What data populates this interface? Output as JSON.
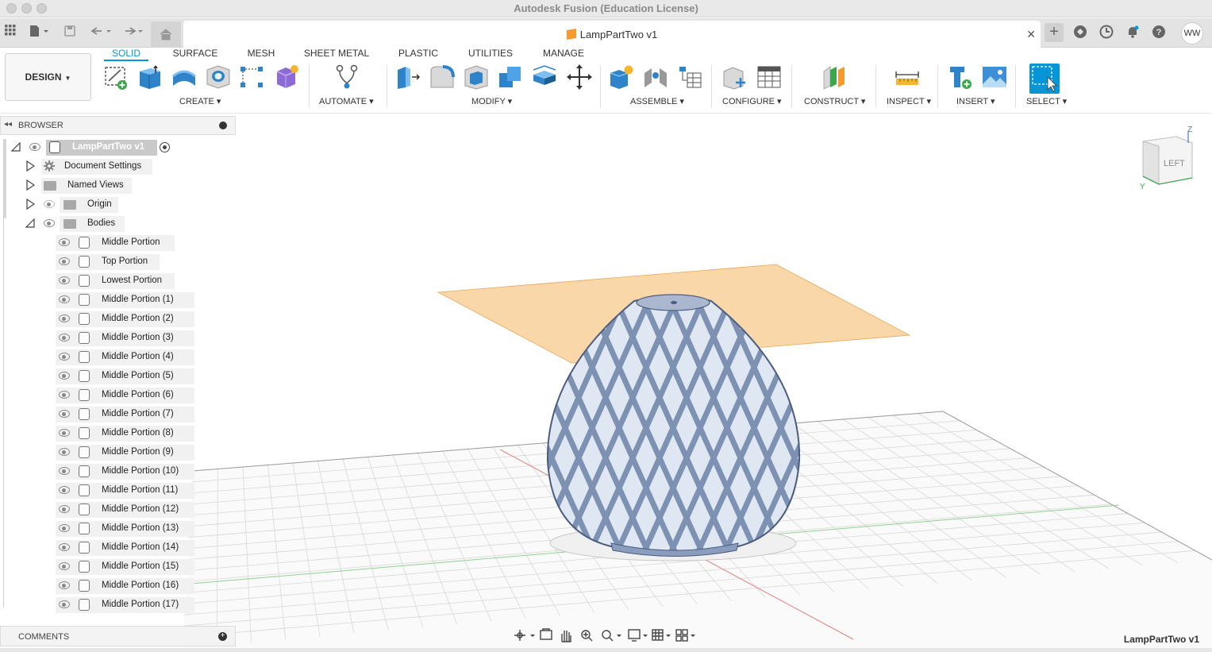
{
  "window": {
    "title": "Autodesk Fusion (Education License)"
  },
  "document_tab": {
    "title": "LampPartTwo v1"
  },
  "user": {
    "initials": "WW"
  },
  "workspace": {
    "label": "DESIGN"
  },
  "tabs": [
    "SOLID",
    "SURFACE",
    "MESH",
    "SHEET METAL",
    "PLASTIC",
    "UTILITIES",
    "MANAGE"
  ],
  "active_tab": "SOLID",
  "groups": {
    "create": "CREATE",
    "automate": "AUTOMATE",
    "modify": "MODIFY",
    "assemble": "ASSEMBLE",
    "configure": "CONFIGURE",
    "construct": "CONSTRUCT",
    "inspect": "INSPECT",
    "insert": "INSERT",
    "select": "SELECT"
  },
  "browser": {
    "title": "BROWSER",
    "root": "LampPartTwo v1",
    "items": [
      "Document Settings",
      "Named Views",
      "Origin",
      "Bodies"
    ],
    "bodies": [
      "Middle Portion",
      "Top Portion",
      "Lowest Portion",
      "Middle Portion (1)",
      "Middle Portion (2)",
      "Middle Portion (3)",
      "Middle Portion (4)",
      "Middle Portion (5)",
      "Middle Portion (6)",
      "Middle Portion (7)",
      "Middle Portion (8)",
      "Middle Portion (9)",
      "Middle Portion (10)",
      "Middle Portion (11)",
      "Middle Portion (12)",
      "Middle Portion (13)",
      "Middle Portion (14)",
      "Middle Portion (15)",
      "Middle Portion (16)",
      "Middle Portion (17)"
    ]
  },
  "comments": {
    "title": "COMMENTS"
  },
  "viewcube": {
    "face": "LEFT",
    "axis_z": "Z",
    "axis_y": "Y"
  },
  "viewport": {
    "document_label": "LampPartTwo v1"
  },
  "colors": {
    "accent": "#0696d7",
    "plane": "#f7c98b",
    "body": "#8a9dbd",
    "grid": "#cfcfcf"
  }
}
